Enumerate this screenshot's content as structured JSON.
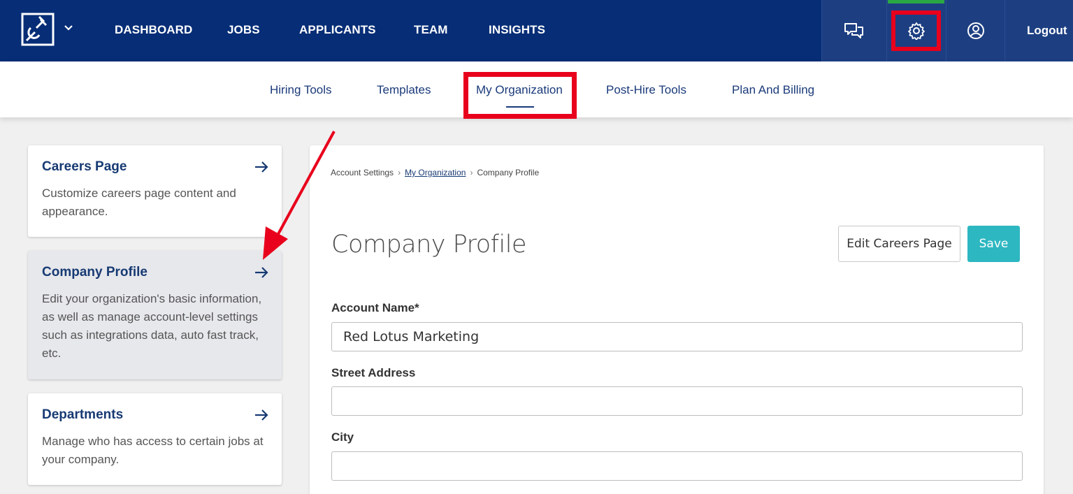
{
  "colors": {
    "navbar": "#062d76",
    "accent_teal": "#2db7c1",
    "highlight_red": "#e8001c",
    "link_blue": "#173a73",
    "active_indicator": "#29a745"
  },
  "topnav": {
    "logo_icon": "company-logo-icon",
    "items": [
      {
        "label": "DASHBOARD"
      },
      {
        "label": "JOBS"
      },
      {
        "label": "APPLICANTS"
      },
      {
        "label": "TEAM"
      },
      {
        "label": "INSIGHTS"
      }
    ],
    "chat_icon": "chat-bubbles-icon",
    "settings_icon": "gear-icon",
    "profile_icon": "user-circle-icon",
    "logout_label": "Logout"
  },
  "subnav": {
    "items": [
      {
        "label": "Hiring Tools"
      },
      {
        "label": "Templates"
      },
      {
        "label": "My Organization"
      },
      {
        "label": "Post-Hire Tools"
      },
      {
        "label": "Plan And Billing"
      }
    ],
    "active": "My Organization"
  },
  "sidebar": {
    "cards": [
      {
        "title": "Careers Page",
        "description": "Customize careers page content and appearance."
      },
      {
        "title": "Company Profile",
        "description": "Edit your organization's basic information, as well as manage account-level settings such as integrations data, auto fast track, etc."
      },
      {
        "title": "Departments",
        "description": "Manage who has access to certain jobs at your company."
      }
    ],
    "active": "Company Profile"
  },
  "main": {
    "breadcrumb": {
      "root": "Account Settings",
      "link": "My Organization",
      "current": "Company Profile"
    },
    "title": "Company Profile",
    "edit_button": "Edit Careers Page",
    "save_button": "Save",
    "fields": {
      "account_name": {
        "label": "Account Name*",
        "value": "Red Lotus Marketing"
      },
      "street_address": {
        "label": "Street Address",
        "value": ""
      },
      "city": {
        "label": "City",
        "value": ""
      }
    }
  }
}
